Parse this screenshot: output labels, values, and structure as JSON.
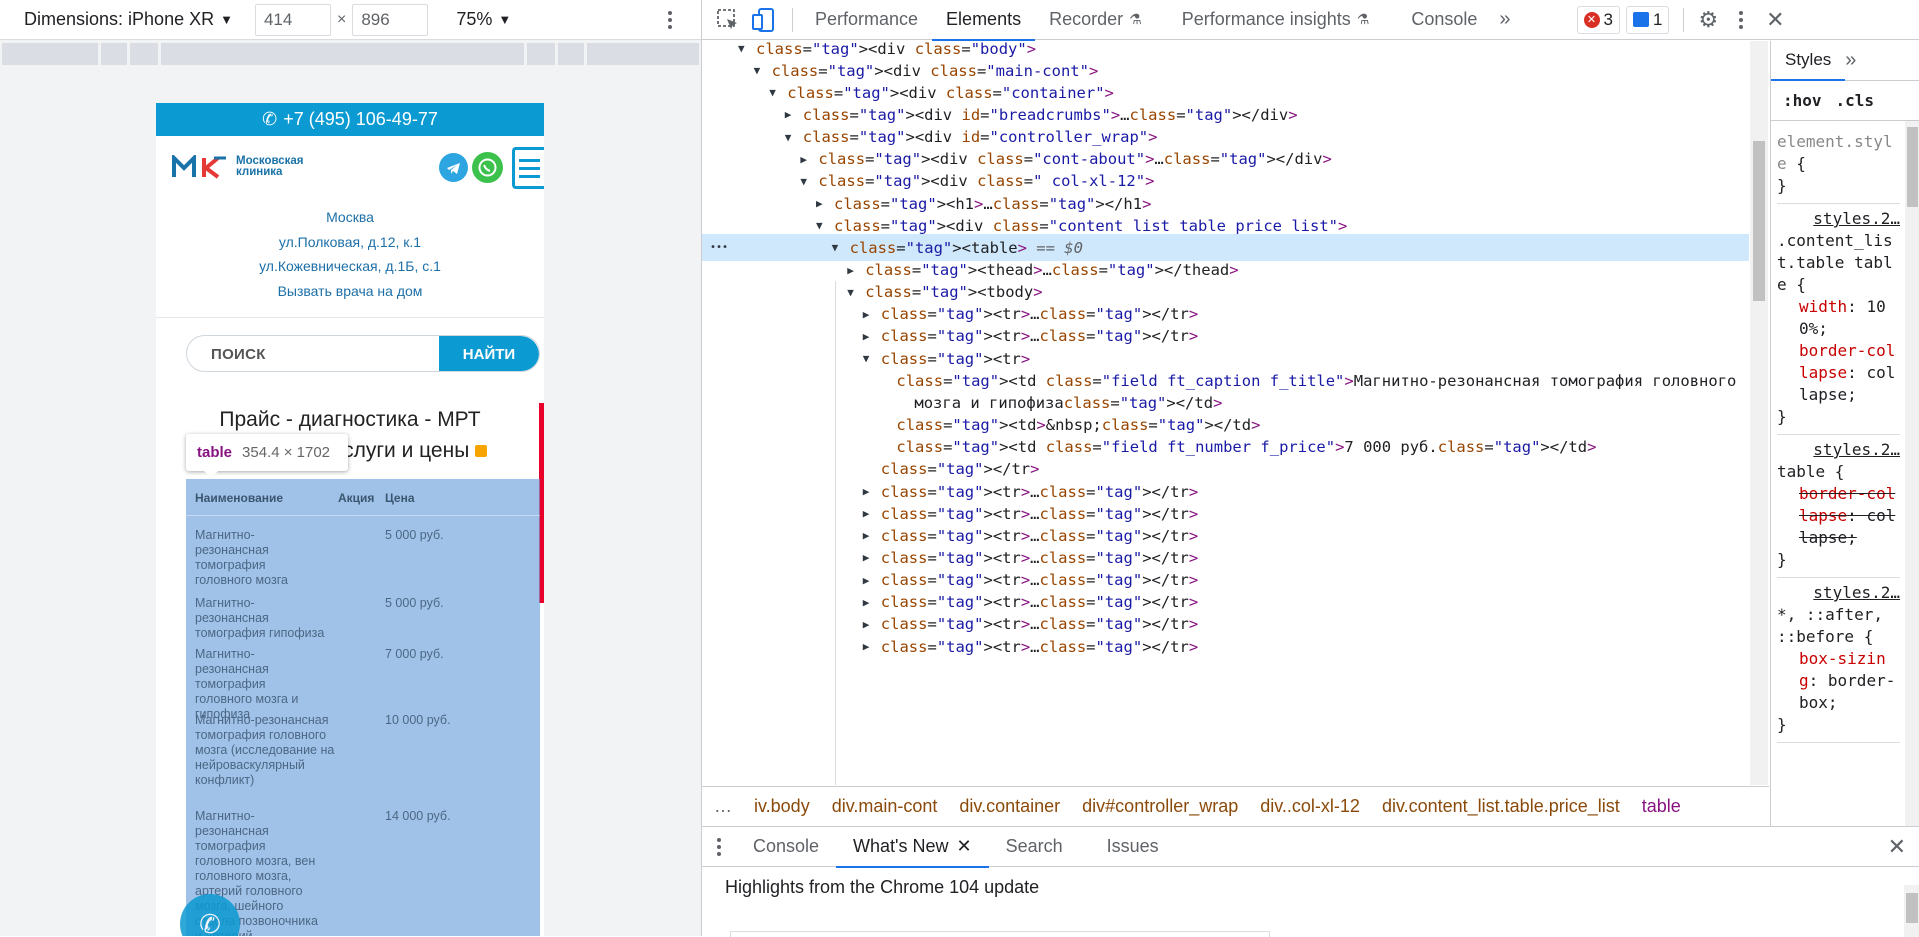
{
  "device_toolbar": {
    "dimensions_label": "Dimensions: iPhone XR",
    "width": "414",
    "height": "896",
    "times": "×",
    "zoom": "75%"
  },
  "site": {
    "phone": "+7 (495) 106-49-77",
    "brand_line1": "Московская",
    "brand_line2": "клиника",
    "city": "Москва",
    "address1": "ул.Полковая, д.12, к.1",
    "address2": "ул.Кожевническая, д.1Б, с.1",
    "call_doctor": "Вызвать врача на дом",
    "search_placeholder": "ПОИСК",
    "search_button": "НАЙТИ",
    "title_line1": "Прайс - диагностика - МРТ",
    "title_line2": "услуги и цены",
    "table_headers": [
      "Наименование",
      "Акция",
      "Цена"
    ],
    "rows": [
      {
        "name": "Магнитно-резонансная томография головного мозга",
        "price": "5 000 руб."
      },
      {
        "name": "Магнитно-резонансная томография гипофиза",
        "price": "5 000 руб."
      },
      {
        "name": "Магнитно-резонансная томография головного мозга и гипофиза",
        "price": "7 000 руб."
      },
      {
        "name": "Магнитно-резонансная томография головного мозга (исследование на нейроваскулярный конфликт)",
        "price": "10 000 руб."
      },
      {
        "name": "Магнитно-резонансная томография головного мозга, вен головного мозга, артерий головного мозга, шейного отдела позвоночника и артерий",
        "price": "14 000 руб."
      }
    ]
  },
  "inspect_tooltip": {
    "tag": "table",
    "size": "354.4 × 1702"
  },
  "devtools": {
    "tabs": [
      "Performance",
      "Elements",
      "Recorder",
      "Performance insights",
      "Console"
    ],
    "active_tab": "Elements",
    "errors": "3",
    "messages": "1",
    "dom_lines": [
      {
        "indent": 0,
        "tri": "▼",
        "html": "<div class=\"body\">"
      },
      {
        "indent": 1,
        "tri": "▼",
        "html": "<div class=\"main-cont\">"
      },
      {
        "indent": 2,
        "tri": "▼",
        "html": "<div class=\"container\">"
      },
      {
        "indent": 3,
        "tri": "▶",
        "html": "<div id=\"breadcrumbs\">…</div>"
      },
      {
        "indent": 3,
        "tri": "▼",
        "html": "<div id=\"controller_wrap\">"
      },
      {
        "indent": 4,
        "tri": "▶",
        "html": "<div class=\"cont-about\">…</div>"
      },
      {
        "indent": 4,
        "tri": "▼",
        "html": "<div class=\" col-xl-12\">"
      },
      {
        "indent": 5,
        "tri": "▶",
        "html": "<h1>…</h1>"
      },
      {
        "indent": 5,
        "tri": "▼",
        "html": "<div class=\"content_list table price_list\">"
      },
      {
        "indent": 6,
        "tri": "▼",
        "html": "<table> == $0"
      },
      {
        "indent": 7,
        "tri": "▶",
        "html": "<thead>…</thead>"
      },
      {
        "indent": 7,
        "tri": "▼",
        "html": "<tbody>"
      },
      {
        "indent": 8,
        "tri": "▶",
        "html": "<tr>…</tr>"
      },
      {
        "indent": 8,
        "tri": "▶",
        "html": "<tr>…</tr>"
      },
      {
        "indent": 8,
        "tri": "▼",
        "html": "<tr>"
      },
      {
        "indent": 9,
        "tri": "",
        "html": "<td class=\"field ft_caption f_title\">Магнитно-резонансная томография головного"
      },
      {
        "indent": 9,
        "tri": "",
        "html": "мозга и гипофиза</td>"
      },
      {
        "indent": 9,
        "tri": "",
        "html": "<td>&nbsp;</td>"
      },
      {
        "indent": 9,
        "tri": "",
        "html": "<td class=\"field ft_number f_price\">7 000 руб.</td>"
      },
      {
        "indent": 8,
        "tri": "",
        "html": "</tr>"
      },
      {
        "indent": 8,
        "tri": "▶",
        "html": "<tr>…</tr>"
      },
      {
        "indent": 8,
        "tri": "▶",
        "html": "<tr>…</tr>"
      },
      {
        "indent": 8,
        "tri": "▶",
        "html": "<tr>…</tr>"
      },
      {
        "indent": 8,
        "tri": "▶",
        "html": "<tr>…</tr>"
      },
      {
        "indent": 8,
        "tri": "▶",
        "html": "<tr>…</tr>"
      },
      {
        "indent": 8,
        "tri": "▶",
        "html": "<tr>…</tr>"
      },
      {
        "indent": 8,
        "tri": "▶",
        "html": "<tr>…</tr>"
      },
      {
        "indent": 8,
        "tri": "▶",
        "html": "<tr>…</tr>"
      }
    ],
    "breadcrumbs": [
      "iv.body",
      "div.main-cont",
      "div.container",
      "div#controller_wrap",
      "div..col-xl-12",
      "div.content_list.table.price_list",
      "table"
    ],
    "styles_tab": "Styles",
    "hov": ":hov",
    "cls": ".cls",
    "style_rules": [
      {
        "source": "",
        "selector": "element.style",
        "props": []
      },
      {
        "source": "styles.2…",
        "selector": ".content_list.table table",
        "props": [
          {
            "name": "width",
            "value": "100%"
          },
          {
            "name": "border-collapse",
            "value": "collapse"
          }
        ]
      },
      {
        "source": "styles.2…",
        "selector": "table",
        "props": [
          {
            "name": "border-collapse",
            "value": "collapse",
            "struck": true
          }
        ]
      },
      {
        "source": "styles.2…",
        "selector": "*, ::after, ::before",
        "props": [
          {
            "name": "box-sizing",
            "value": "border-box"
          }
        ]
      }
    ],
    "drawer_tabs": [
      "Console",
      "What's New",
      "Search",
      "Issues"
    ],
    "drawer_active": "What's New",
    "drawer_heading": "Highlights from the Chrome 104 update"
  },
  "colors": {
    "accent": "#1a73e8",
    "site_blue": "#0b9ad1",
    "tag": "#881280",
    "attr_name": "#994500",
    "attr_value": "#1a1aa6",
    "highlight": "#6fa1dc"
  }
}
